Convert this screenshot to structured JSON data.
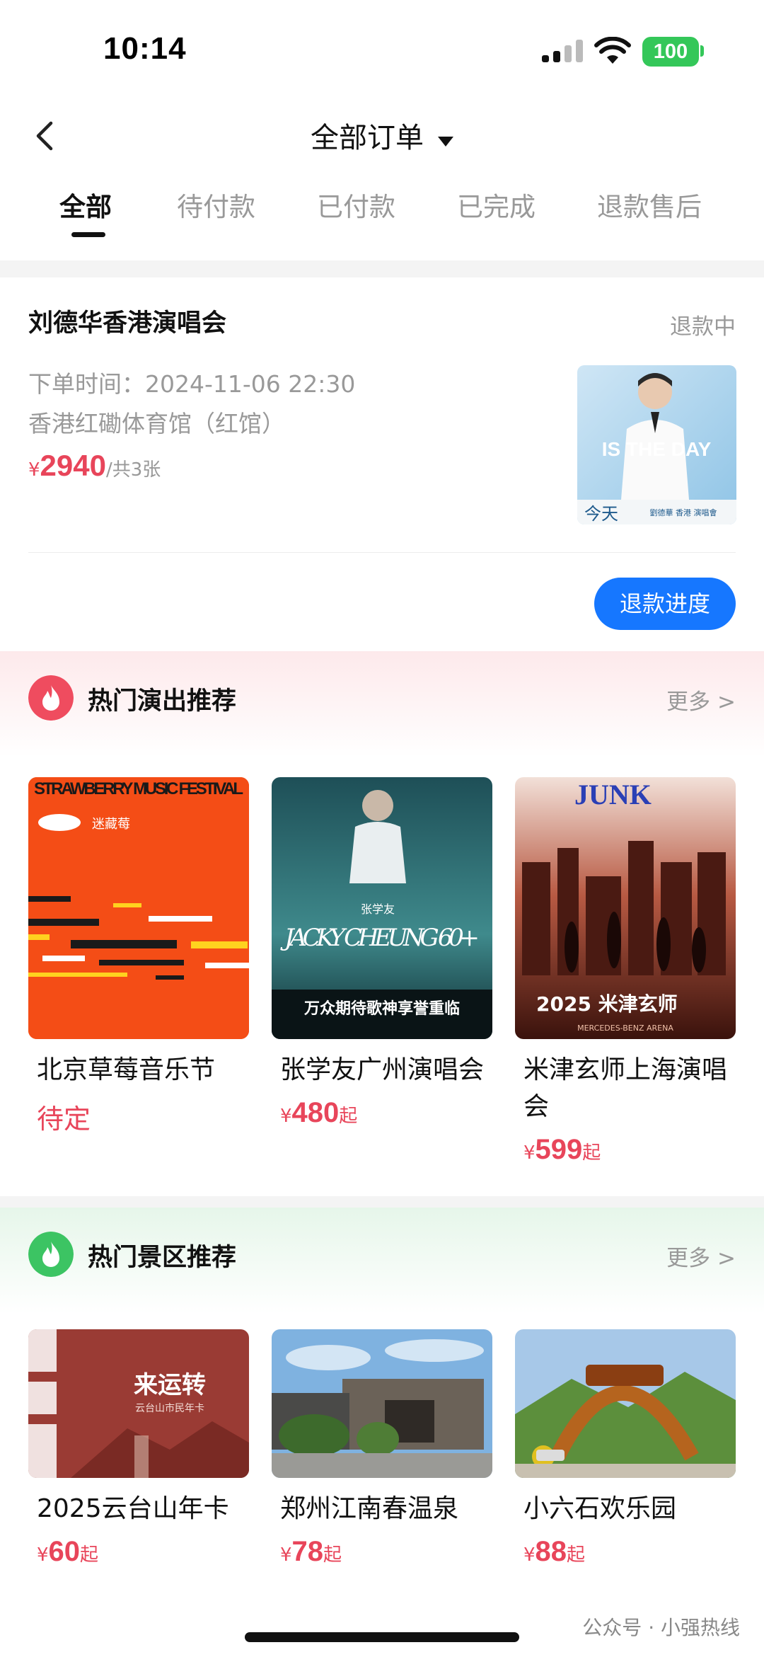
{
  "status_bar": {
    "time": "10:14",
    "battery": "100"
  },
  "nav": {
    "title": "全部订单"
  },
  "tabs": [
    {
      "label": "全部",
      "active": true
    },
    {
      "label": "待付款"
    },
    {
      "label": "已付款"
    },
    {
      "label": "已完成"
    },
    {
      "label": "退款售后"
    }
  ],
  "order": {
    "title": "刘德华香港演唱会",
    "status": "退款中",
    "time": "下单时间：2024-11-06 22:30",
    "venue": "香港红磡体育馆（红馆）",
    "price_symbol": "¥",
    "price": "2940",
    "count": "/共3张",
    "poster": {
      "big_text": "IS THE DAY",
      "name_text": "今天",
      "artist_text": "劉德華 香港 演唱會"
    },
    "action_label": "退款进度"
  },
  "shows": {
    "title": "热门演出推荐",
    "more": "更多 >",
    "items": [
      {
        "name": "北京草莓音乐节",
        "price_text": "待定",
        "poster_text": "STRAWBERRY MUSIC FESTIVAL",
        "poster_logo": "迷藏莓"
      },
      {
        "name": "张学友广州演唱会",
        "price_symbol": "¥",
        "price": "480",
        "price_suffix": "起",
        "poster_text": "JACKY CHEUNG 60+",
        "poster_sub": "万众期待歌神享誉重临",
        "poster_tag": "张学友"
      },
      {
        "name": "米津玄师上海演唱会",
        "price_symbol": "¥",
        "price": "599",
        "price_suffix": "起",
        "poster_text": "JUNK",
        "poster_sub": "2025 米津玄师",
        "poster_tag": "MERCEDES-BENZ ARENA"
      }
    ]
  },
  "scenic": {
    "title": "热门景区推荐",
    "more": "更多 >",
    "items": [
      {
        "name": "2025云台山年卡",
        "price_symbol": "¥",
        "price": "60",
        "price_suffix": "起",
        "poster_text": "来运转",
        "poster_sub": "云台山市民年卡"
      },
      {
        "name": "郑州江南春温泉",
        "price_symbol": "¥",
        "price": "78",
        "price_suffix": "起"
      },
      {
        "name": "小六石欢乐园",
        "price_symbol": "¥",
        "price": "88",
        "price_suffix": "起"
      }
    ]
  },
  "watermark": "公众号 · 小强热线",
  "colors": {
    "accent": "#1677ff",
    "price": "#e8455a",
    "hot_show": "#ef4c5f",
    "hot_scenic": "#3cc463"
  }
}
